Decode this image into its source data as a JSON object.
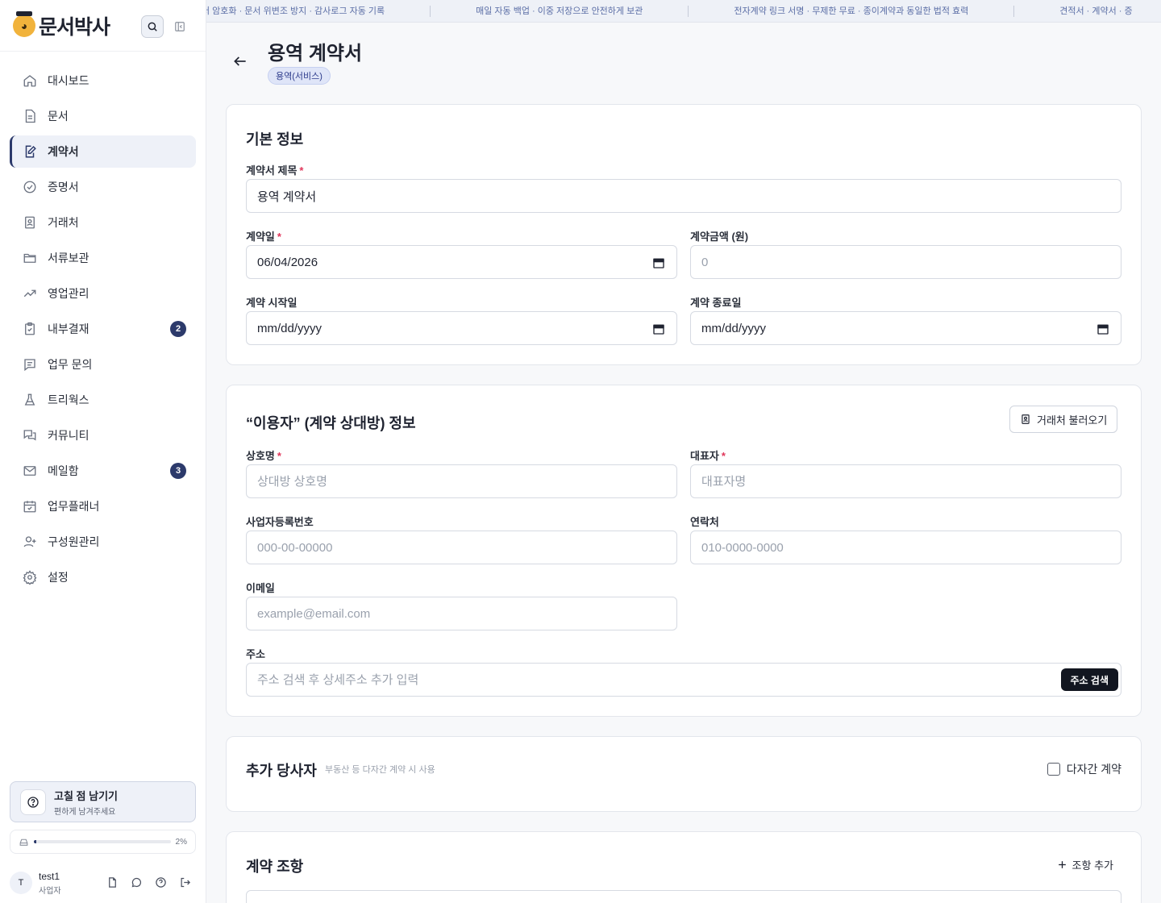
{
  "brand": {
    "name": "문서박사"
  },
  "sidebar": {
    "items": [
      {
        "label": "대시보드",
        "icon": "home-icon"
      },
      {
        "label": "문서",
        "icon": "document-icon"
      },
      {
        "label": "계약서",
        "icon": "contract-edit-icon",
        "active": true
      },
      {
        "label": "증명서",
        "icon": "check-badge-icon"
      },
      {
        "label": "거래처",
        "icon": "contact-book-icon"
      },
      {
        "label": "서류보관",
        "icon": "folder-icon"
      },
      {
        "label": "영업관리",
        "icon": "trending-up-icon"
      },
      {
        "label": "내부결재",
        "icon": "clipboard-check-icon",
        "badge": "2"
      },
      {
        "label": "업무 문의",
        "icon": "message-square-icon"
      },
      {
        "label": "트리웍스",
        "icon": "flask-icon"
      },
      {
        "label": "커뮤니티",
        "icon": "chat-bubbles-icon"
      },
      {
        "label": "메일함",
        "icon": "mail-icon",
        "badge": "3"
      },
      {
        "label": "업무플래너",
        "icon": "calendar-check-icon"
      },
      {
        "label": "구성원관리",
        "icon": "user-plus-icon"
      },
      {
        "label": "설정",
        "icon": "gear-icon"
      }
    ],
    "feedback": {
      "title": "고칠 점 남기기",
      "subtitle": "편하게 남겨주세요"
    },
    "storage": {
      "percent_label": "2%",
      "fraction": 0.02
    },
    "user": {
      "initial": "T",
      "name": "test1",
      "role": "사업자"
    }
  },
  "marquee": [
    "터 암호화 · 문서 위변조 방지 · 감사로그 자동 기록",
    "매일 자동 백업 · 이중 저장으로 안전하게 보관",
    "전자계약 링크 서명 · 무제한 무료 · 종이계약과 동일한 법적 효력",
    "견적서 · 계약서 · 증"
  ],
  "page": {
    "title": "용역 계약서",
    "tag": "용역(서비스)"
  },
  "basic": {
    "title": "기본 정보",
    "contract_title_label": "계약서 제목",
    "contract_title_value": "용역 계약서",
    "contract_date_label": "계약일",
    "contract_date_value": "06/04/2026",
    "amount_label": "계약금액 (원)",
    "amount_placeholder": "0",
    "start_label": "계약 시작일",
    "start_value": "mm/dd/yyyy",
    "end_label": "계약 종료일",
    "end_value": "mm/dd/yyyy"
  },
  "party": {
    "title": "“이용자” (계약 상대방) 정보",
    "load_button": "거래처 불러오기",
    "company_label": "상호명",
    "company_placeholder": "상대방 상호명",
    "ceo_label": "대표자",
    "ceo_placeholder": "대표자명",
    "bizno_label": "사업자등록번호",
    "bizno_placeholder": "000-00-00000",
    "phone_label": "연락처",
    "phone_placeholder": "010-0000-0000",
    "email_label": "이메일",
    "email_placeholder": "example@email.com",
    "address_label": "주소",
    "address_placeholder": "주소 검색 후 상세주소 추가 입력",
    "address_button": "주소 검색"
  },
  "extra": {
    "title": "추가 당사자",
    "hint": "부동산 등 다자간 계약 시 사용",
    "checkbox_label": "다자간 계약"
  },
  "clauses": {
    "title": "계약 조항",
    "add_button": "조항 추가"
  },
  "colors": {
    "accent": "#2c3a6b",
    "required": "#e0365a"
  }
}
